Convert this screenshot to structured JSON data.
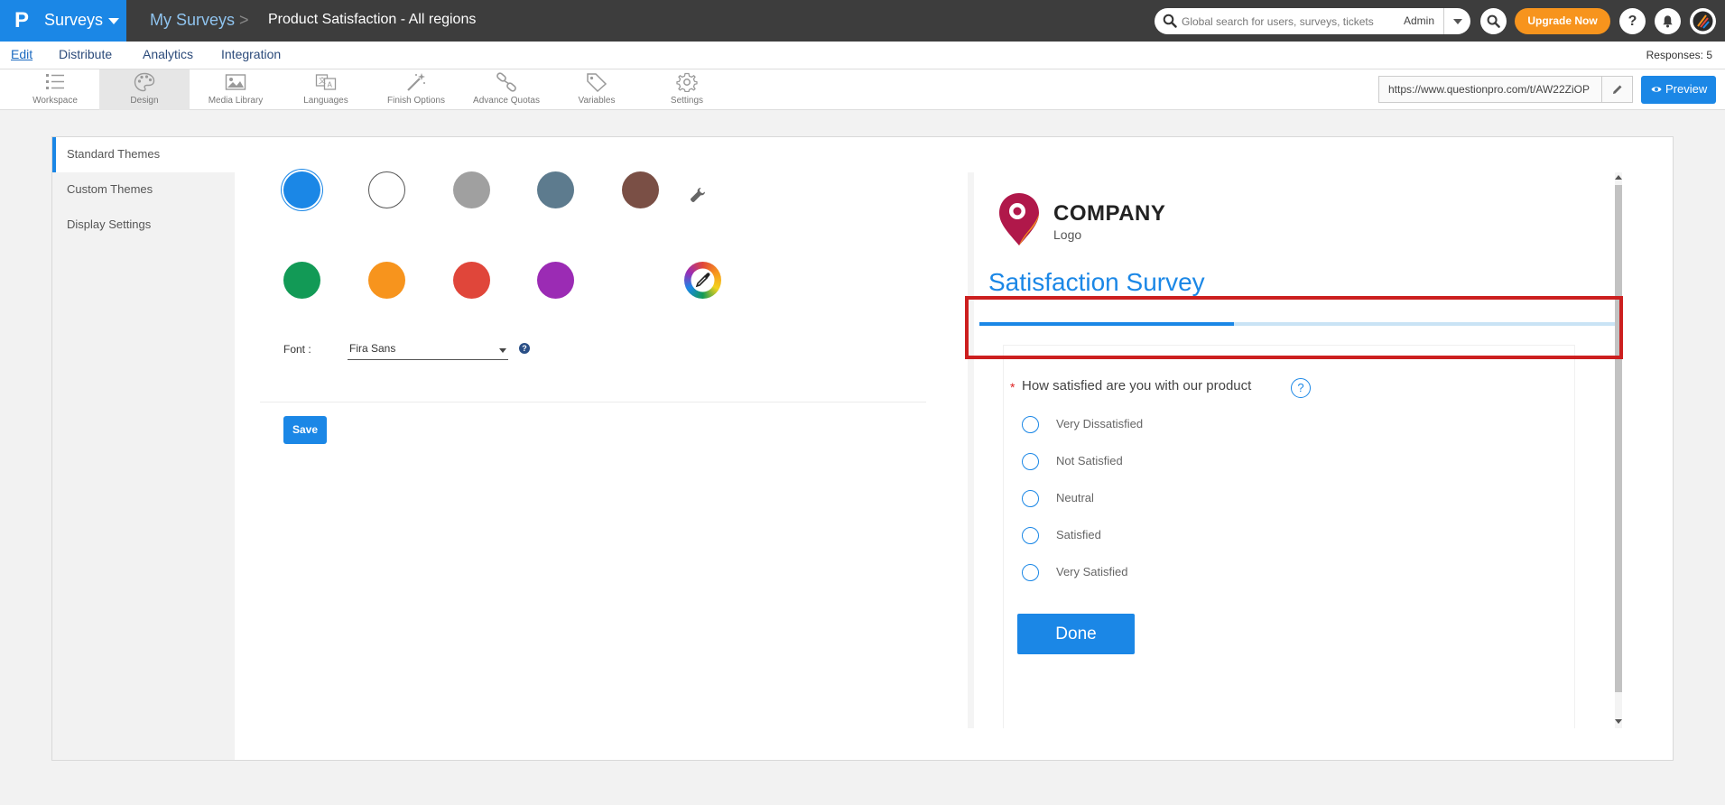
{
  "topbar": {
    "brand_logo": "P",
    "brand_name": "Surveys",
    "breadcrumb_root": "My Surveys",
    "breadcrumb_sep": ">",
    "survey_title": "Product Satisfaction - All regions",
    "search_placeholder": "Global search for users, surveys, tickets",
    "search_scope": "Admin",
    "upgrade_label": "Upgrade Now",
    "help_label": "?"
  },
  "menubar": {
    "items": [
      {
        "label": "Edit",
        "active": true
      },
      {
        "label": "Distribute"
      },
      {
        "label": "Analytics"
      },
      {
        "label": "Integration"
      }
    ],
    "responses": "Responses: 5"
  },
  "toolbar": {
    "tools": [
      {
        "label": "Workspace",
        "icon": "workspace-icon"
      },
      {
        "label": "Design",
        "icon": "palette-icon",
        "active": true
      },
      {
        "label": "Media Library",
        "icon": "image-icon"
      },
      {
        "label": "Languages",
        "icon": "translate-icon"
      },
      {
        "label": "Finish Options",
        "icon": "magic-wand-icon"
      },
      {
        "label": "Advance Quotas",
        "icon": "chain-icon"
      },
      {
        "label": "Variables",
        "icon": "tag-icon"
      },
      {
        "label": "Settings",
        "icon": "gear-icon"
      }
    ],
    "survey_url": "https://www.questionpro.com/t/AW22ZiOP",
    "preview_label": "Preview"
  },
  "sidebar": {
    "items": [
      {
        "label": "Standard Themes",
        "active": true
      },
      {
        "label": "Custom Themes"
      },
      {
        "label": "Display Settings"
      }
    ]
  },
  "themes": {
    "colors": [
      "#1b87e6",
      "#ffffff",
      "#a0a0a0",
      "#5d7b8e",
      "#7a4f45",
      "#129a56",
      "#f7941d",
      "#e0463a",
      "#9b2bb4"
    ],
    "selected_color": "#1b87e6",
    "font_label": "Font :",
    "font_value": "Fira Sans",
    "help_label": "?",
    "save_label": "Save"
  },
  "preview": {
    "company": "COMPANY",
    "logo_sub": "Logo",
    "survey_title": "Satisfaction Survey",
    "progress": 0.4,
    "required_mark": "*",
    "question": "How satisfied are you with our product",
    "help_label": "?",
    "options": [
      "Very Dissatisfied",
      "Not Satisfied",
      "Neutral",
      "Satisfied",
      "Very Satisfied"
    ],
    "done_label": "Done"
  }
}
